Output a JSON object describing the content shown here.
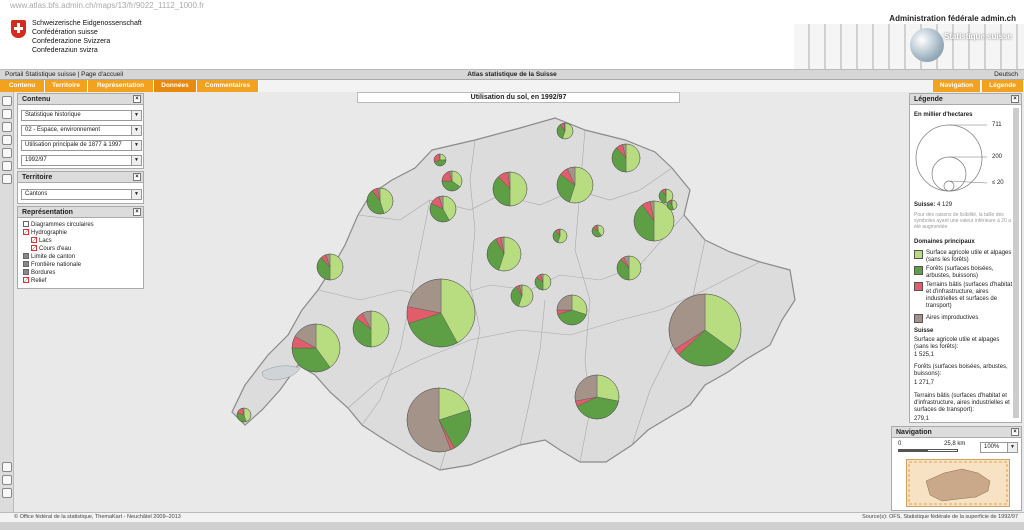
{
  "browser": {
    "url": "www.atlas.bfs.admin.ch/maps/13/fr/9022_1112_1000.fr"
  },
  "header": {
    "confederation_lines": [
      "Schweizerische Eidgenossenschaft",
      "Confédération suisse",
      "Confederazione Svizzera",
      "Confederaziun svizra"
    ],
    "admin": "Administration fédérale admin.ch",
    "brand": "Statistique suisse"
  },
  "topbar": {
    "portal": "Portail Statistique suisse  |  Page d'accueil",
    "title": "Atlas statistique de la Suisse",
    "language": "Deutsch"
  },
  "tabs": {
    "left": [
      "Contenu",
      "Territoire",
      "Représentation",
      "Données",
      "Commentaires"
    ],
    "right": [
      "Navigation",
      "Légende"
    ]
  },
  "contenu": {
    "title": "Contenu",
    "selects": [
      "Statistique historique",
      "02 - Espace, environnement",
      "Utilisation principale de 1877 à 1997",
      "1992/97"
    ]
  },
  "territoire": {
    "title": "Territoire",
    "select": "Cantons"
  },
  "representation": {
    "title": "Représentation",
    "layers": [
      "Diagrammes circulaires",
      "Hydrographie",
      "Lacs",
      "Cours d'eau",
      "Limite de canton",
      "Frontière nationale",
      "Bordures",
      "Relief"
    ]
  },
  "map": {
    "title": "Utilisation du sol, en 1992/97",
    "colors": {
      "agri": "#b8dd80",
      "forest": "#5e9e44",
      "built": "#e25d6c",
      "unprod": "#a39388"
    }
  },
  "legend": {
    "title": "Légende",
    "unit": "En millier d'hectares",
    "size_labels": [
      "711",
      "200",
      "≤ 20"
    ],
    "suisse_label": "Suisse:",
    "suisse_value": "4 129",
    "note": "Pour des raisons de lisibilité, la taille des symboles ayant une valeur inférieure à 20 a été augmentée",
    "domains_title": "Domaines principaux",
    "domains": [
      "Surface agricole utile et alpages (sans les forêts)",
      "Forêts (surfaces boisées, arbustes, buissons)",
      "Terrains bâtis (surfaces d'habitat et d'infrastructure, aires industrielles et surfaces de transport)",
      "Aires improductives"
    ],
    "values_title": "Suisse",
    "values": [
      {
        "label": "Surface agricole utile et alpages (sans les forêts):",
        "value": "1 525,1"
      },
      {
        "label": "Forêts (surfaces boisées, arbustes, buissons):",
        "value": "1 271,7"
      },
      {
        "label": "Terrains bâtis (surfaces d'habitat et d'infrastructure, aires industrielles et surfaces de transport):",
        "value": "279,1"
      }
    ]
  },
  "navigation": {
    "title": "Navigation",
    "scale_zero": "0",
    "scale_km": "25,8 km",
    "zoom": "100%"
  },
  "footer": {
    "left": "© Office fédéral de la statistique, ThemaKart - Neuchâtel 2009–2013",
    "right": "Source(s): OFS, Statistique fédérale de la superficie de 1992/97"
  }
}
